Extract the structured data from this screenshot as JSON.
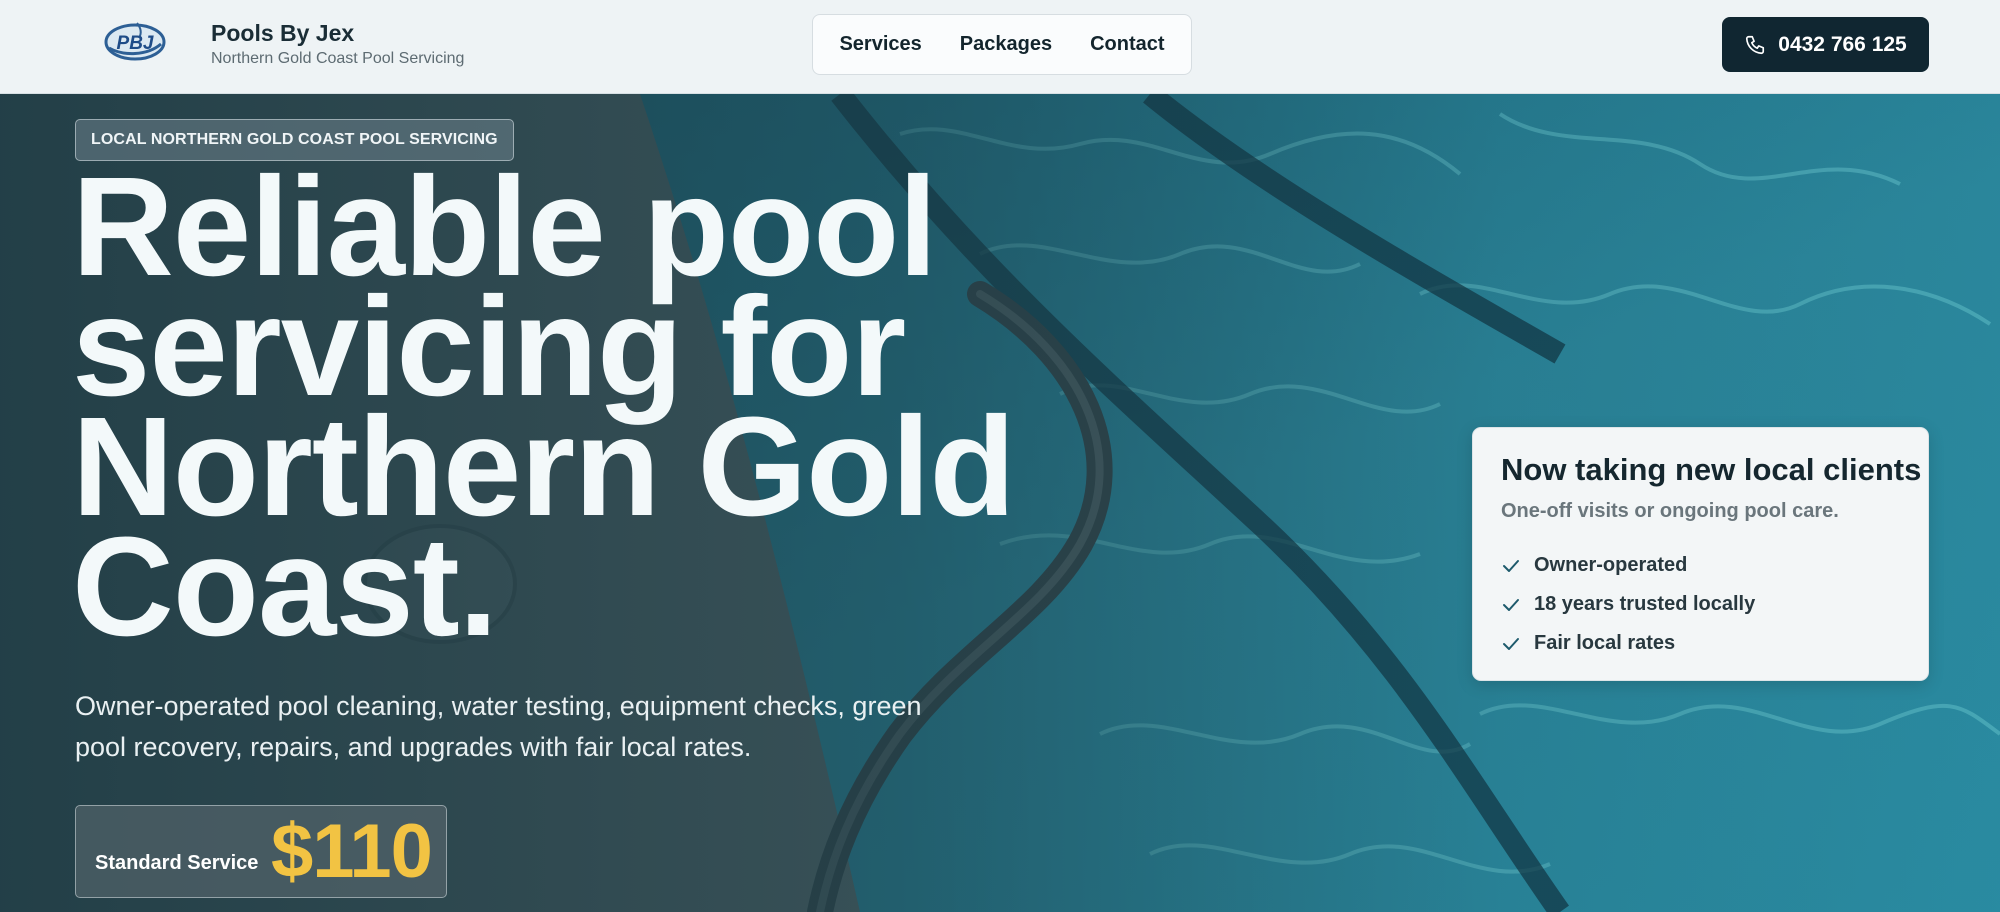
{
  "header": {
    "logo_text": "PBJ",
    "brand_title": "Pools By Jex",
    "brand_subtitle": "Northern Gold Coast Pool Servicing",
    "nav": [
      {
        "label": "Services"
      },
      {
        "label": "Packages"
      },
      {
        "label": "Contact"
      }
    ],
    "phone": {
      "label": "0432 766 125",
      "icon": "phone-icon"
    }
  },
  "hero": {
    "eyebrow": "LOCAL NORTHERN GOLD COAST POOL SERVICING",
    "headline_lines": [
      "Reliable pool",
      "servicing for",
      "Northern Gold",
      "Coast."
    ],
    "subcopy_lines": [
      "Owner-operated pool cleaning, water testing, equipment checks, green",
      "pool recovery, repairs, and upgrades with fair local rates."
    ],
    "price": {
      "label": "Standard Service",
      "value": "$110"
    }
  },
  "clients_card": {
    "title": "Now taking new local clients",
    "subtitle": "One-off visits or ongoing pool care.",
    "items": [
      {
        "label": "Owner-operated",
        "icon": "check-icon"
      },
      {
        "label": "18 years trusted locally",
        "icon": "check-icon"
      },
      {
        "label": "Fair local rates",
        "icon": "check-icon"
      }
    ]
  },
  "colors": {
    "header_bg": "#eef3f5",
    "dark_button": "#102631",
    "price_accent": "#f2c343",
    "water": "#1f7f94"
  }
}
